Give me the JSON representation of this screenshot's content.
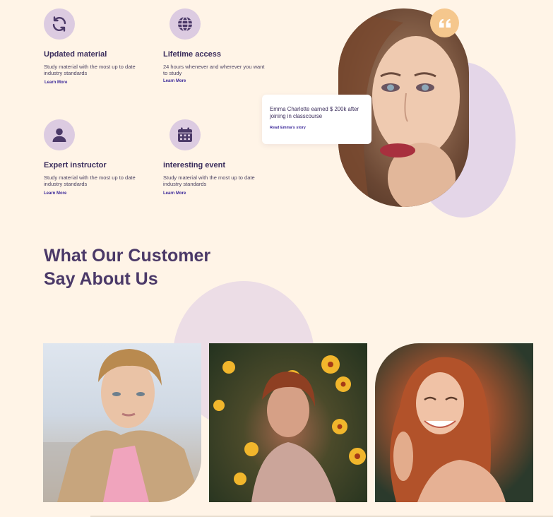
{
  "features": [
    {
      "title": "Updated material",
      "desc": "Study material with the most up to date industry standards",
      "link": "Learn More",
      "icon": "refresh-icon"
    },
    {
      "title": "Lifetime access",
      "desc": "24 hours whenever and wherever you want to study",
      "link": "Learn More",
      "icon": "globe-icon"
    },
    {
      "title": "Expert instructor",
      "desc": "Study material with the most up to date industry standards",
      "link": "Learn More",
      "icon": "user-icon"
    },
    {
      "title": "interesting event",
      "desc": "Study material with the most up to date industry standards",
      "link": "Learn More",
      "icon": "calendar-icon"
    }
  ],
  "story": {
    "text": "Emma  Charlotte earned $ 200k after joining in classcourse",
    "link": "Read Emma's story"
  },
  "section": {
    "heading_line1": "What Our Customer",
    "heading_line2": "Say About Us"
  },
  "colors": {
    "background": "#fff4e7",
    "icon_circle": "#dccbe1",
    "accent_link": "#3d2a9a",
    "quote_badge": "#f5c78d",
    "heading": "#4b3968"
  }
}
